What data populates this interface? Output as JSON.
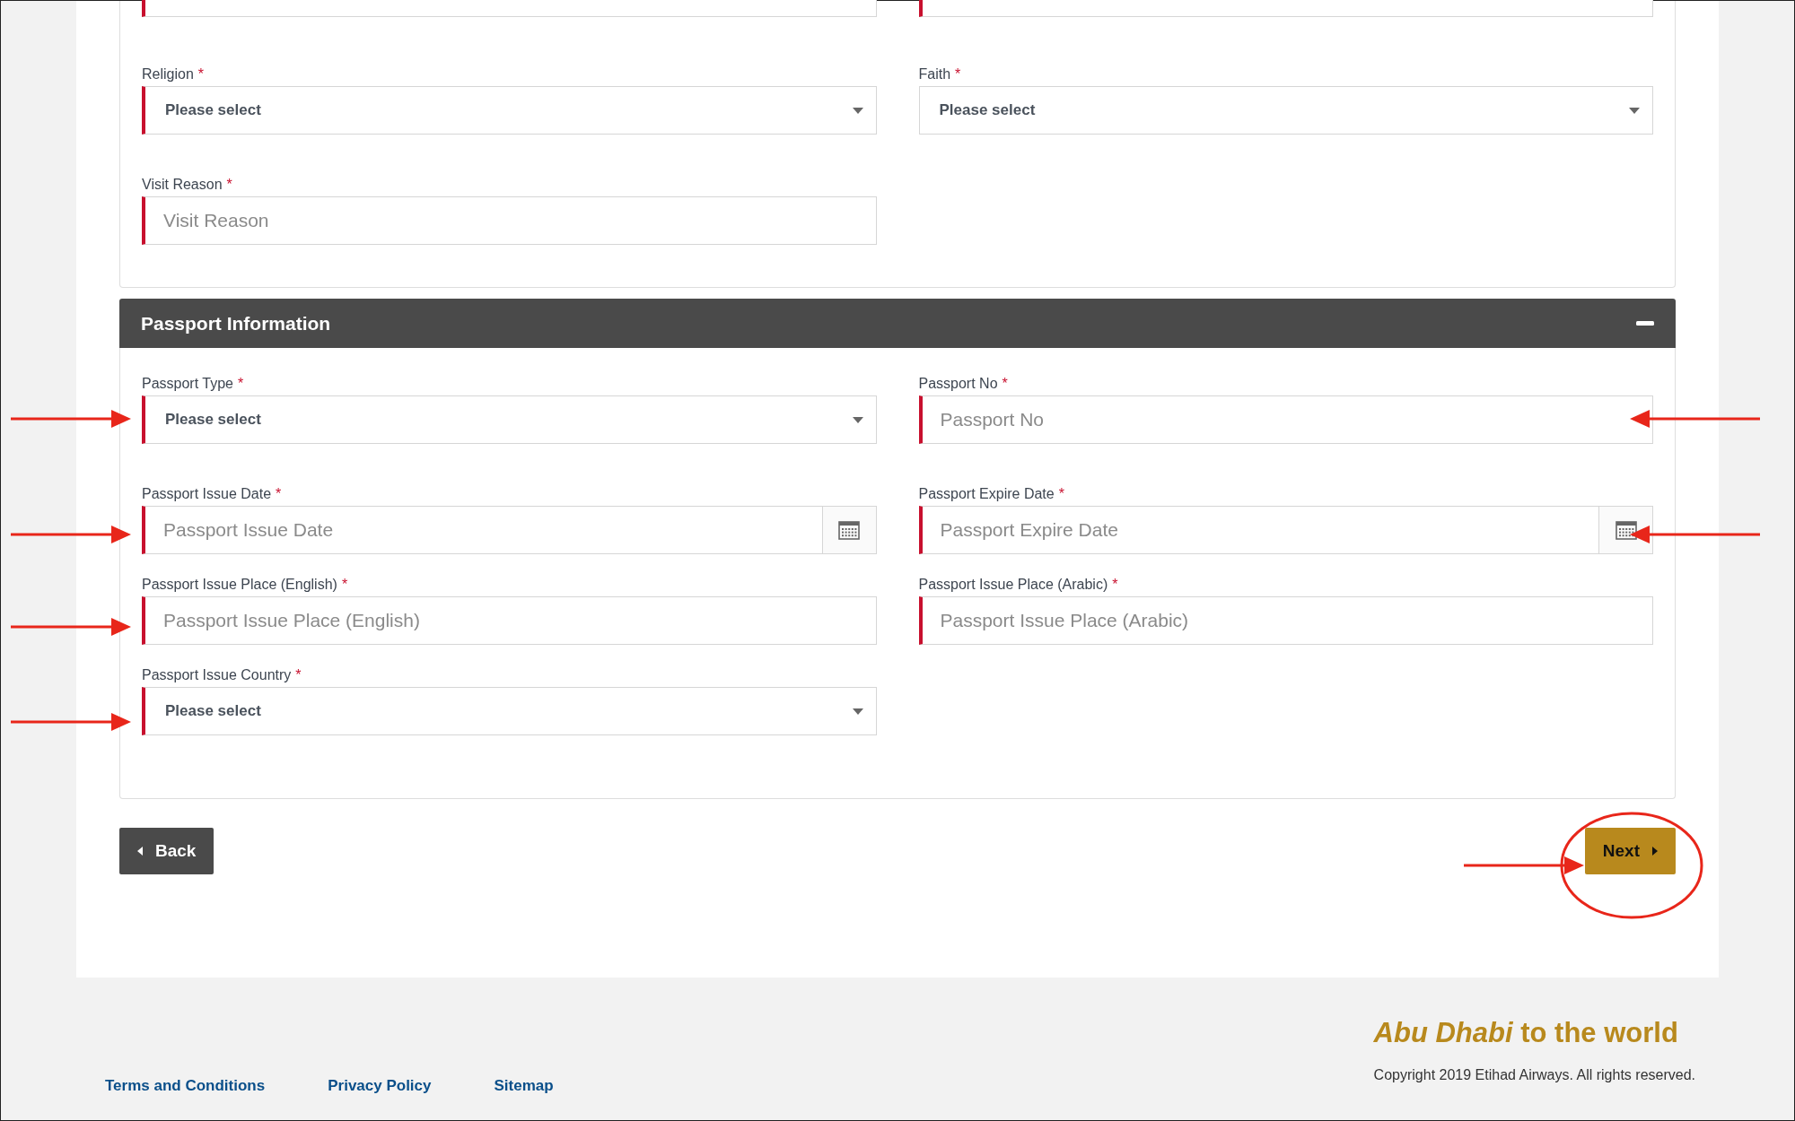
{
  "personal_section": {
    "fields": [
      {
        "kind": "text",
        "invalid": true
      },
      {
        "kind": "text",
        "invalid": true
      },
      {
        "kind": "select",
        "label": "Religion",
        "required_mark": "*",
        "invalid": true,
        "value": "Please select"
      },
      {
        "kind": "select",
        "label": "Faith",
        "required_mark": "*",
        "invalid": false,
        "value": "Please select"
      },
      {
        "kind": "text",
        "label": "Visit Reason",
        "required_mark": "*",
        "invalid": true,
        "placeholder": "Visit Reason"
      }
    ]
  },
  "passport_section": {
    "title": "Passport Information",
    "expanded": true,
    "fields": [
      {
        "kind": "select",
        "label": "Passport Type",
        "required_mark": "*",
        "invalid": true,
        "value": "Please select"
      },
      {
        "kind": "text",
        "label": "Passport No",
        "required_mark": "*",
        "invalid": true,
        "placeholder": "Passport No"
      },
      {
        "kind": "date",
        "label": "Passport Issue Date",
        "required_mark": "*",
        "invalid": true,
        "placeholder": "Passport Issue Date"
      },
      {
        "kind": "date",
        "label": "Passport Expire Date",
        "required_mark": "*",
        "invalid": true,
        "placeholder": "Passport Expire Date"
      },
      {
        "kind": "text",
        "label": "Passport Issue Place (English)",
        "required_mark": "*",
        "invalid": true,
        "placeholder": "Passport Issue Place (English)"
      },
      {
        "kind": "text",
        "label": "Passport Issue Place (Arabic)",
        "required_mark": "*",
        "invalid": true,
        "placeholder": "Passport Issue Place (Arabic)"
      },
      {
        "kind": "select",
        "label": "Passport Issue Country",
        "required_mark": "*",
        "invalid": true,
        "value": "Please select"
      }
    ]
  },
  "buttons": {
    "back": "Back",
    "next": "Next"
  },
  "footer": {
    "links": [
      "Terms and Conditions",
      "Privacy Policy",
      "Sitemap"
    ],
    "tagline": "*Abu Dhabi* to the world",
    "copyright": "Copyright 2019 Etihad Airways. All rights reserved."
  }
}
